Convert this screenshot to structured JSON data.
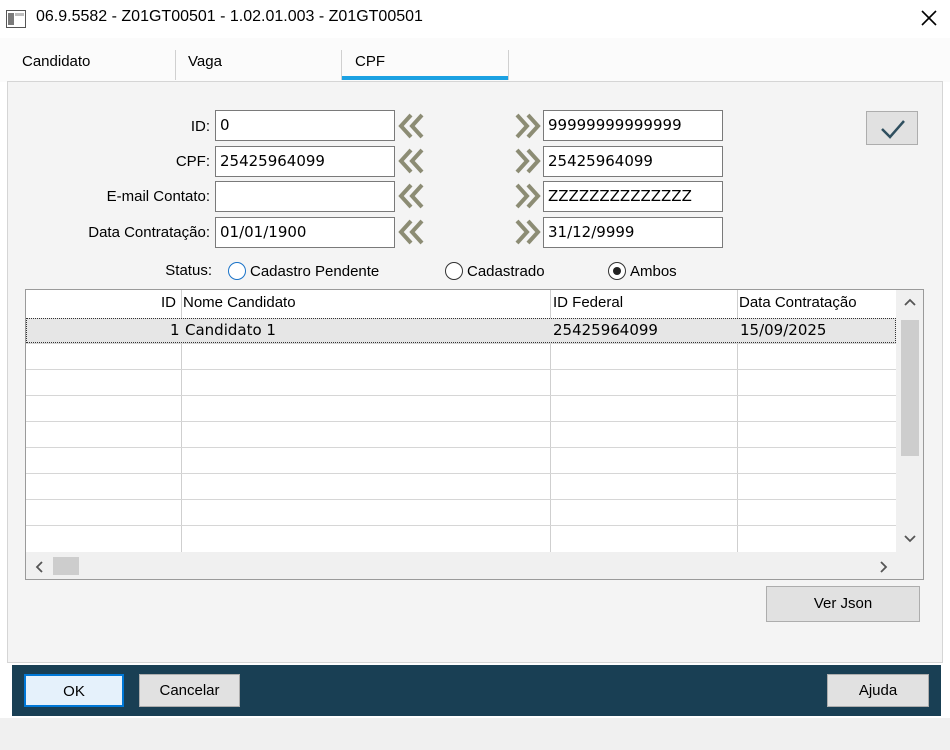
{
  "window": {
    "title": "06.9.5582 - Z01GT00501 - 1.02.01.003 - Z01GT00501"
  },
  "tabs": [
    {
      "label": "Candidato",
      "active": false
    },
    {
      "label": "Vaga",
      "active": false
    },
    {
      "label": "CPF",
      "active": true
    }
  ],
  "accent_color": "#1ba1e2",
  "footer_color": "#193f54",
  "filters": [
    {
      "label": "ID:",
      "from": "0",
      "to": "99999999999999"
    },
    {
      "label": "CPF:",
      "from": "25425964099",
      "to": "25425964099"
    },
    {
      "label": "E-mail Contato:",
      "from": "",
      "to": "ZZZZZZZZZZZZZZ"
    },
    {
      "label": "Data Contratação:",
      "from": "01/01/1900",
      "to": "31/12/9999"
    }
  ],
  "status": {
    "label": "Status:",
    "options": [
      {
        "label": "Cadastro Pendente",
        "selected": false
      },
      {
        "label": "Cadastrado",
        "selected": false
      },
      {
        "label": "Ambos",
        "selected": true
      }
    ]
  },
  "grid": {
    "columns": [
      "ID",
      "Nome Candidato",
      "ID Federal",
      "Data Contratação"
    ],
    "rows": [
      [
        "1",
        "Candidato 1",
        "25425964099",
        "15/09/2025"
      ]
    ]
  },
  "buttons": {
    "ver_json": "Ver Json",
    "ok": "OK",
    "cancelar": "Cancelar",
    "ajuda": "Ajuda"
  }
}
